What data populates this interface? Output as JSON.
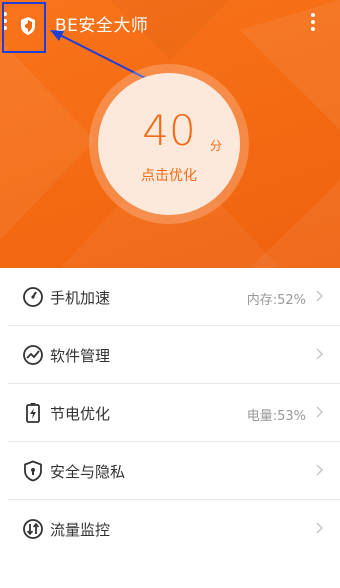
{
  "header": {
    "app_title": "BE安全大师",
    "menu_icon": "menu-icon",
    "logo_icon": "shield-icon",
    "more_icon": "more-vertical-icon",
    "accent_color": "#f36a12",
    "highlight_color": "#1f3fd8"
  },
  "score": {
    "value": "40",
    "unit": "分",
    "action_label": "点击优化"
  },
  "features": [
    {
      "label": "手机加速",
      "value": "内存:52%",
      "icon": "speedometer-icon"
    },
    {
      "label": "软件管理",
      "value": "",
      "icon": "trend-chart-icon"
    },
    {
      "label": "节电优化",
      "value": "电量:53%",
      "icon": "battery-icon"
    },
    {
      "label": "安全与隐私",
      "value": "",
      "icon": "shield-lock-icon"
    },
    {
      "label": "流量监控",
      "value": "",
      "icon": "data-traffic-icon"
    }
  ]
}
